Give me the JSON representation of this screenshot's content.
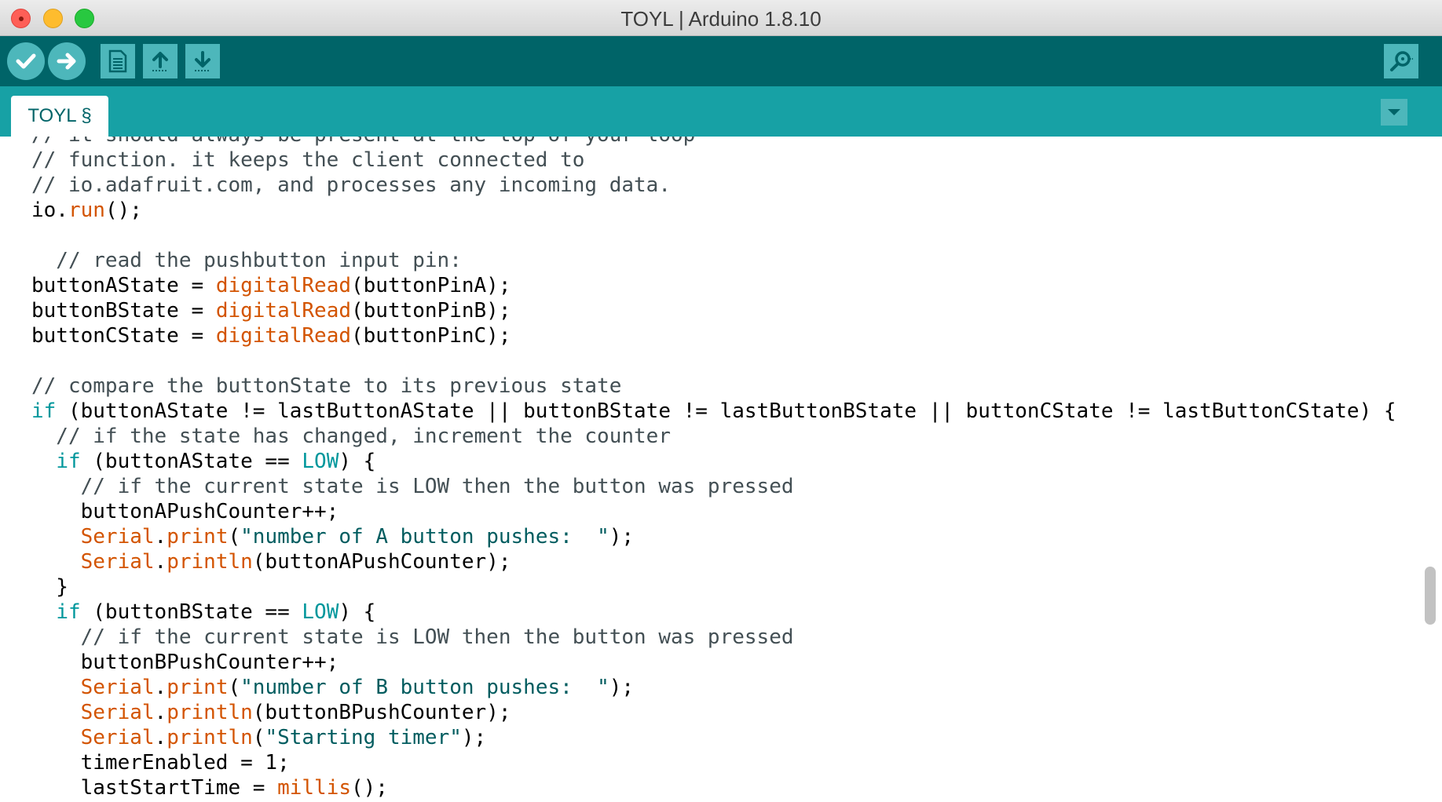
{
  "window": {
    "title": "TOYL | Arduino 1.8.10"
  },
  "toolbar": {
    "buttons": [
      {
        "name": "verify",
        "icon": "check-icon"
      },
      {
        "name": "upload",
        "icon": "arrow-right-icon"
      },
      {
        "name": "new",
        "icon": "new-file-icon"
      },
      {
        "name": "open",
        "icon": "arrow-up-icon"
      },
      {
        "name": "save",
        "icon": "arrow-down-icon"
      },
      {
        "name": "serial-monitor",
        "icon": "magnifier-icon"
      }
    ]
  },
  "tabs": [
    {
      "label": "TOYL §"
    }
  ],
  "colors": {
    "toolbar": "#006468",
    "tabbar": "#17a1a5",
    "button": "#4db7bb",
    "comment": "#434f54",
    "function": "#d35400",
    "keyword": "#00979c",
    "string": "#005c5f"
  },
  "code_lines": [
    [
      [
        "// it should always be present at the top of your loop",
        "comment"
      ]
    ],
    [
      [
        "// function. it keeps the client connected to",
        "comment"
      ]
    ],
    [
      [
        "// io.adafruit.com, and processes any incoming data.",
        "comment"
      ]
    ],
    [
      [
        "io.",
        "plain"
      ],
      [
        "run",
        "func"
      ],
      [
        "();",
        "plain"
      ]
    ],
    [],
    [
      [
        "  // read the pushbutton input pin:",
        "comment"
      ]
    ],
    [
      [
        "buttonAState = ",
        "plain"
      ],
      [
        "digitalRead",
        "func"
      ],
      [
        "(buttonPinA);",
        "plain"
      ]
    ],
    [
      [
        "buttonBState = ",
        "plain"
      ],
      [
        "digitalRead",
        "func"
      ],
      [
        "(buttonPinB);",
        "plain"
      ]
    ],
    [
      [
        "buttonCState = ",
        "plain"
      ],
      [
        "digitalRead",
        "func"
      ],
      [
        "(buttonPinC);",
        "plain"
      ]
    ],
    [],
    [
      [
        "// compare the buttonState to its previous state",
        "comment"
      ]
    ],
    [
      [
        "if",
        "kw"
      ],
      [
        " (buttonAState != lastButtonAState || buttonBState != lastButtonBState || buttonCState != lastButtonCState) {",
        "plain"
      ]
    ],
    [
      [
        "  // if the state has changed, increment the counter",
        "comment"
      ]
    ],
    [
      [
        "  ",
        "plain"
      ],
      [
        "if",
        "kw"
      ],
      [
        " (buttonAState == ",
        "plain"
      ],
      [
        "LOW",
        "kw"
      ],
      [
        ") {",
        "plain"
      ]
    ],
    [
      [
        "    // if the current state is LOW then the button was pressed",
        "comment"
      ]
    ],
    [
      [
        "    buttonAPushCounter++;",
        "plain"
      ]
    ],
    [
      [
        "    ",
        "plain"
      ],
      [
        "Serial",
        "func"
      ],
      [
        ".",
        "plain"
      ],
      [
        "print",
        "func"
      ],
      [
        "(",
        "plain"
      ],
      [
        "\"number of A button pushes:  \"",
        "str"
      ],
      [
        ");",
        "plain"
      ]
    ],
    [
      [
        "    ",
        "plain"
      ],
      [
        "Serial",
        "func"
      ],
      [
        ".",
        "plain"
      ],
      [
        "println",
        "func"
      ],
      [
        "(buttonAPushCounter);",
        "plain"
      ]
    ],
    [
      [
        "  }",
        "plain"
      ]
    ],
    [
      [
        "  ",
        "plain"
      ],
      [
        "if",
        "kw"
      ],
      [
        " (buttonBState == ",
        "plain"
      ],
      [
        "LOW",
        "kw"
      ],
      [
        ") {",
        "plain"
      ]
    ],
    [
      [
        "    // if the current state is LOW then the button was pressed",
        "comment"
      ]
    ],
    [
      [
        "    buttonBPushCounter++;",
        "plain"
      ]
    ],
    [
      [
        "    ",
        "plain"
      ],
      [
        "Serial",
        "func"
      ],
      [
        ".",
        "plain"
      ],
      [
        "print",
        "func"
      ],
      [
        "(",
        "plain"
      ],
      [
        "\"number of B button pushes:  \"",
        "str"
      ],
      [
        ");",
        "plain"
      ]
    ],
    [
      [
        "    ",
        "plain"
      ],
      [
        "Serial",
        "func"
      ],
      [
        ".",
        "plain"
      ],
      [
        "println",
        "func"
      ],
      [
        "(buttonBPushCounter);",
        "plain"
      ]
    ],
    [
      [
        "    ",
        "plain"
      ],
      [
        "Serial",
        "func"
      ],
      [
        ".",
        "plain"
      ],
      [
        "println",
        "func"
      ],
      [
        "(",
        "plain"
      ],
      [
        "\"Starting timer\"",
        "str"
      ],
      [
        ");",
        "plain"
      ]
    ],
    [
      [
        "    timerEnabled = 1;",
        "plain"
      ]
    ],
    [
      [
        "    lastStartTime = ",
        "plain"
      ],
      [
        "millis",
        "func"
      ],
      [
        "();",
        "plain"
      ]
    ]
  ]
}
